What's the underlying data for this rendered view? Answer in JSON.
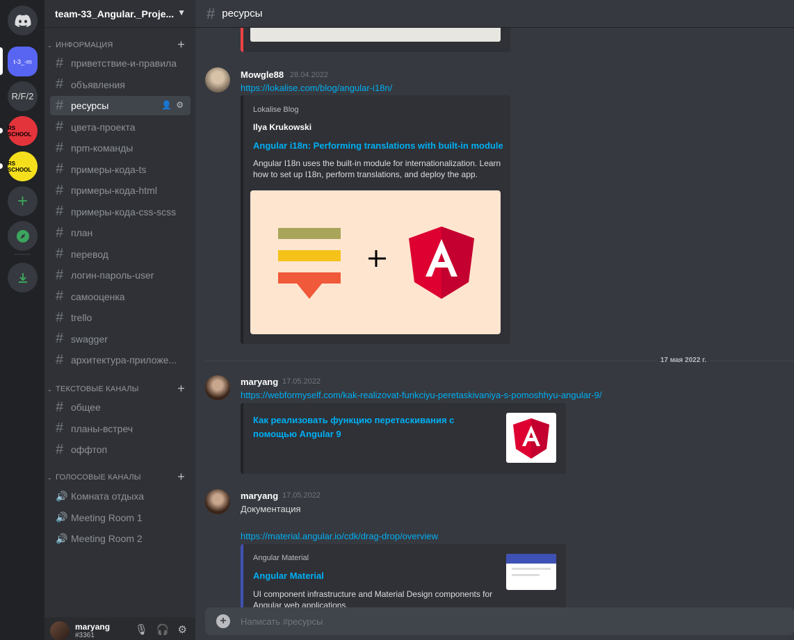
{
  "guild": {
    "name": "team-33_Angular._Proje...",
    "icons": [
      {
        "label": "t-3_-m",
        "color": "#5865f2",
        "active": true
      },
      {
        "label": "R/F/2",
        "color": "#36393f"
      },
      {
        "label": "RS SCHOOL",
        "color": "#ed4245"
      },
      {
        "label": "RS SCHOOL",
        "color": "#fee75c"
      }
    ]
  },
  "sidebar": {
    "categories": {
      "info": "ИНФОРМАЦИЯ",
      "text": "ТЕКСТОВЫЕ КАНАЛЫ",
      "voice": "ГОЛОСОВЫЕ КАНАЛЫ"
    },
    "info_channels": [
      "приветствие-и-правила",
      "объявления",
      "ресурсы",
      "цвета-проекта",
      "npm-команды",
      "примеры-кода-ts",
      "примеры-кода-html",
      "примеры-кода-css-scss",
      "план",
      "перевод",
      "логин-пароль-user",
      "самооценка",
      "trello",
      "swagger",
      "архитектура-приложе..."
    ],
    "text_channels": [
      "общее",
      "планы-встреч",
      "оффтоп"
    ],
    "voice_channels": [
      "Комната отдыха",
      "Meeting Room 1",
      "Meeting Room 2"
    ]
  },
  "user": {
    "name": "maryang",
    "tag": "#3361"
  },
  "channel": {
    "name": "ресурсы",
    "placeholder": "Написать #ресурсы"
  },
  "messages": [
    {
      "author": "Mowgle88",
      "time": "28.04.2022",
      "link": "https://lokalise.com/blog/angular-i18n/",
      "embed": {
        "provider": "Lokalise Blog",
        "author": "Ilya Krukowski",
        "title": "Angular i18n: Performing translations with built-in module",
        "desc_line1": "Angular I18n uses the built-in module for internationalization. Learn",
        "desc_line2": "how to set up I18n, perform translations, and deploy the app."
      }
    },
    {
      "author": "maryang",
      "time": "17.05.2022",
      "link": "https://webformyself.com/kak-realizovat-funkciyu-peretaskivaniya-s-pomoshhyu-angular-9/",
      "embed": {
        "title_line1": "Как реализовать функцию перетаскивания с",
        "title_line2": "помощью Angular 9"
      }
    },
    {
      "author": "maryang",
      "time": "17.05.2022",
      "text": "Документация",
      "link": "https://material.angular.io/cdk/drag-drop/overview",
      "embed": {
        "provider": "Angular Material",
        "title": "Angular Material",
        "desc_line1": "UI component infrastructure and Material Design components for",
        "desc_line2": "Angular web applications."
      }
    }
  ],
  "date_divider": "17 мая 2022 г."
}
